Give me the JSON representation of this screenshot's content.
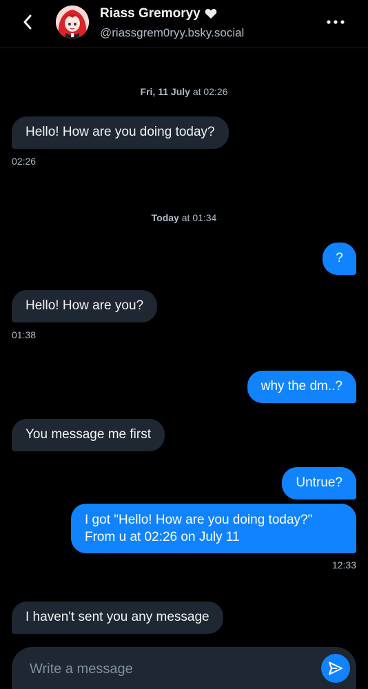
{
  "header": {
    "back_icon": "chevron-left-icon",
    "avatar_alt": "profile avatar",
    "name": "Riass Gremoryy",
    "name_icon": "heart-icon",
    "handle": "@riassgrem0ryy.bsky.social",
    "more_icon": "more-horizontal-icon"
  },
  "conversation": {
    "separators": [
      {
        "day": "Fri, 11 July",
        "connector": "at",
        "time": "02:26"
      },
      {
        "day": "Today",
        "connector": "at",
        "time": "01:34"
      }
    ],
    "messages": [
      {
        "direction": "incoming",
        "text": "Hello! How are you doing today?",
        "timestamp": "02:26"
      },
      {
        "direction": "outgoing",
        "text": "?"
      },
      {
        "direction": "incoming",
        "text": "Hello! How are you?",
        "timestamp": "01:38"
      },
      {
        "direction": "outgoing",
        "text": "why the dm..?"
      },
      {
        "direction": "incoming",
        "text": "You message me first"
      },
      {
        "direction": "outgoing",
        "text": "Untrue?"
      },
      {
        "direction": "outgoing",
        "line1": "I got \"Hello! How are you doing today?\"",
        "line2": "From u at 02:26 on July 11",
        "timestamp": "12:33"
      },
      {
        "direction": "incoming",
        "text": "I haven't sent you any message"
      }
    ]
  },
  "composer": {
    "placeholder": "Write a message",
    "value": "",
    "send_icon": "send-icon"
  },
  "colors": {
    "background": "#000000",
    "incoming_bubble": "#1e2732",
    "outgoing_bubble": "#1183fe",
    "muted_text": "#aebbc9",
    "accent": "#1183fe"
  }
}
